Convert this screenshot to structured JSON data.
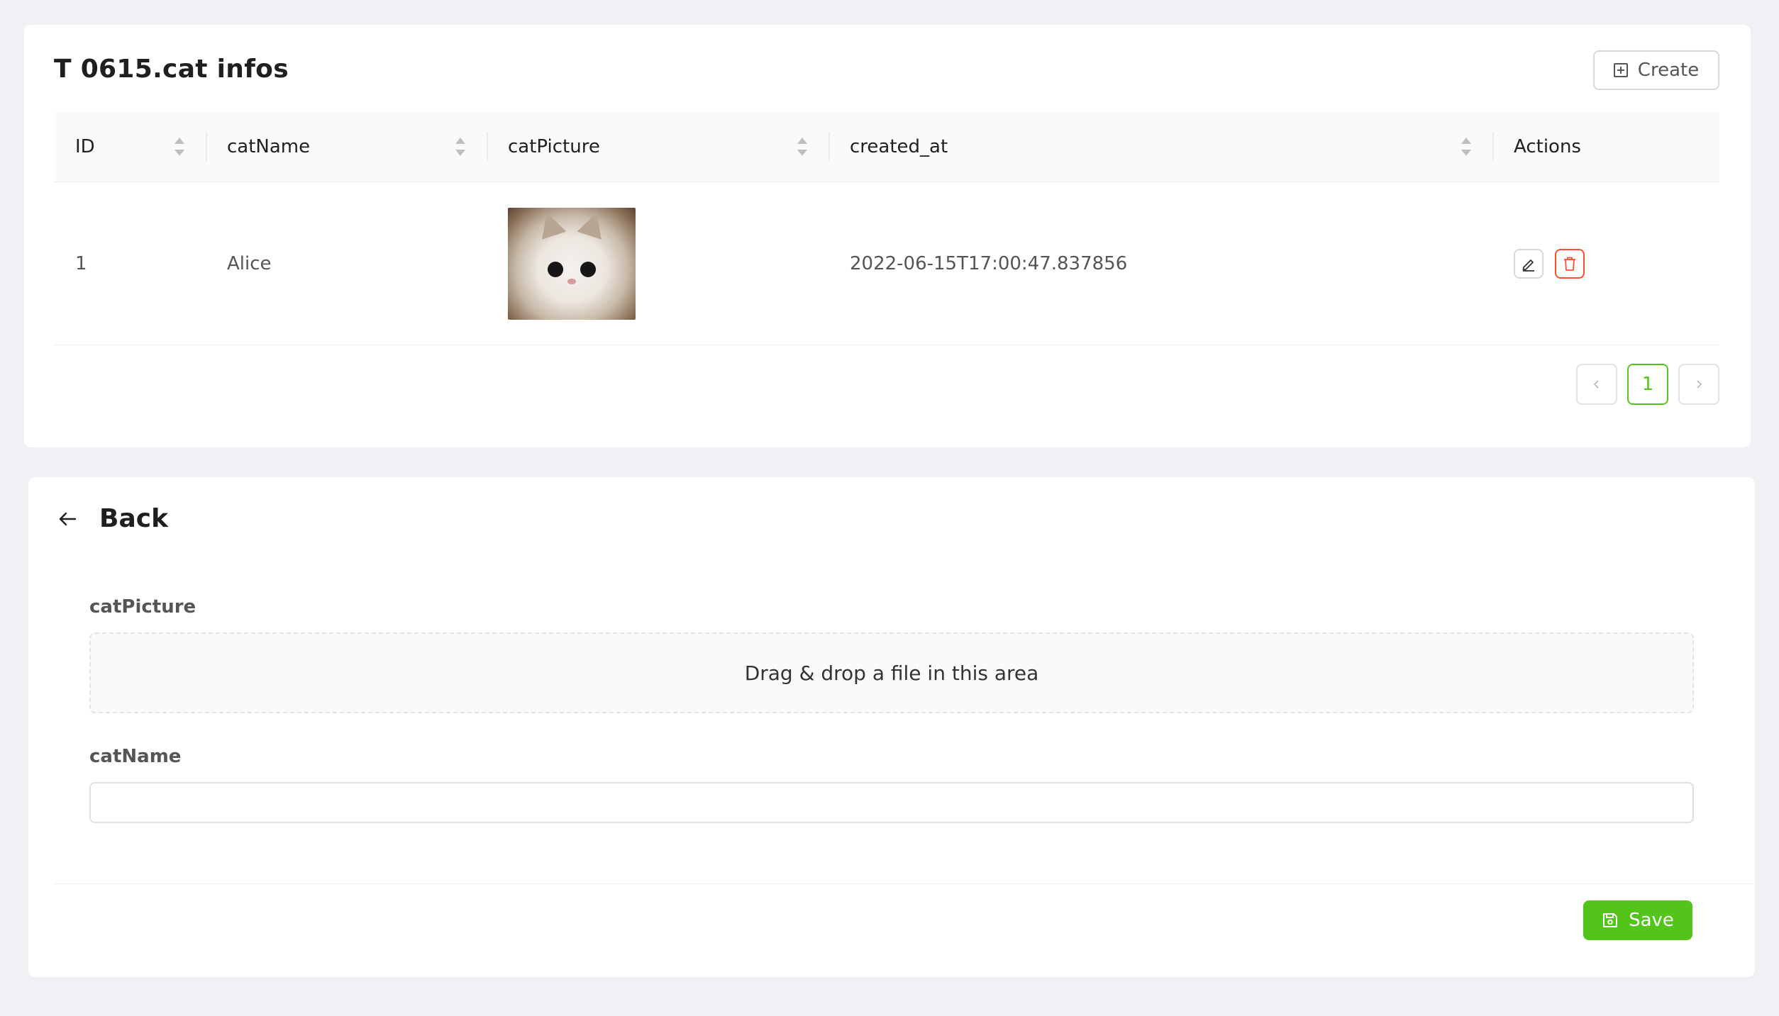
{
  "list": {
    "title": "T 0615.cat infos",
    "create_label": "Create",
    "columns": [
      {
        "label": "ID",
        "sortable": true
      },
      {
        "label": "catName",
        "sortable": true
      },
      {
        "label": "catPicture",
        "sortable": true
      },
      {
        "label": "created_at",
        "sortable": true
      },
      {
        "label": "Actions",
        "sortable": false
      }
    ],
    "rows": [
      {
        "id": "1",
        "catName": "Alice",
        "catPicture": "cat-photo",
        "created_at": "2022-06-15T17:00:47.837856"
      }
    ],
    "pagination": {
      "prev_icon": "chevron-left-icon",
      "current_page": "1",
      "next_icon": "chevron-right-icon"
    }
  },
  "form": {
    "back_label": "Back",
    "fields": [
      {
        "label": "catPicture",
        "type": "file",
        "dropzone_text": "Drag & drop a file in this area"
      },
      {
        "label": "catName",
        "type": "text",
        "value": "",
        "placeholder": ""
      }
    ],
    "save_label": "Save"
  },
  "colors": {
    "accent": "#52c41a",
    "danger": "#ff4d2e",
    "page_bg": "#f0f1f4"
  }
}
